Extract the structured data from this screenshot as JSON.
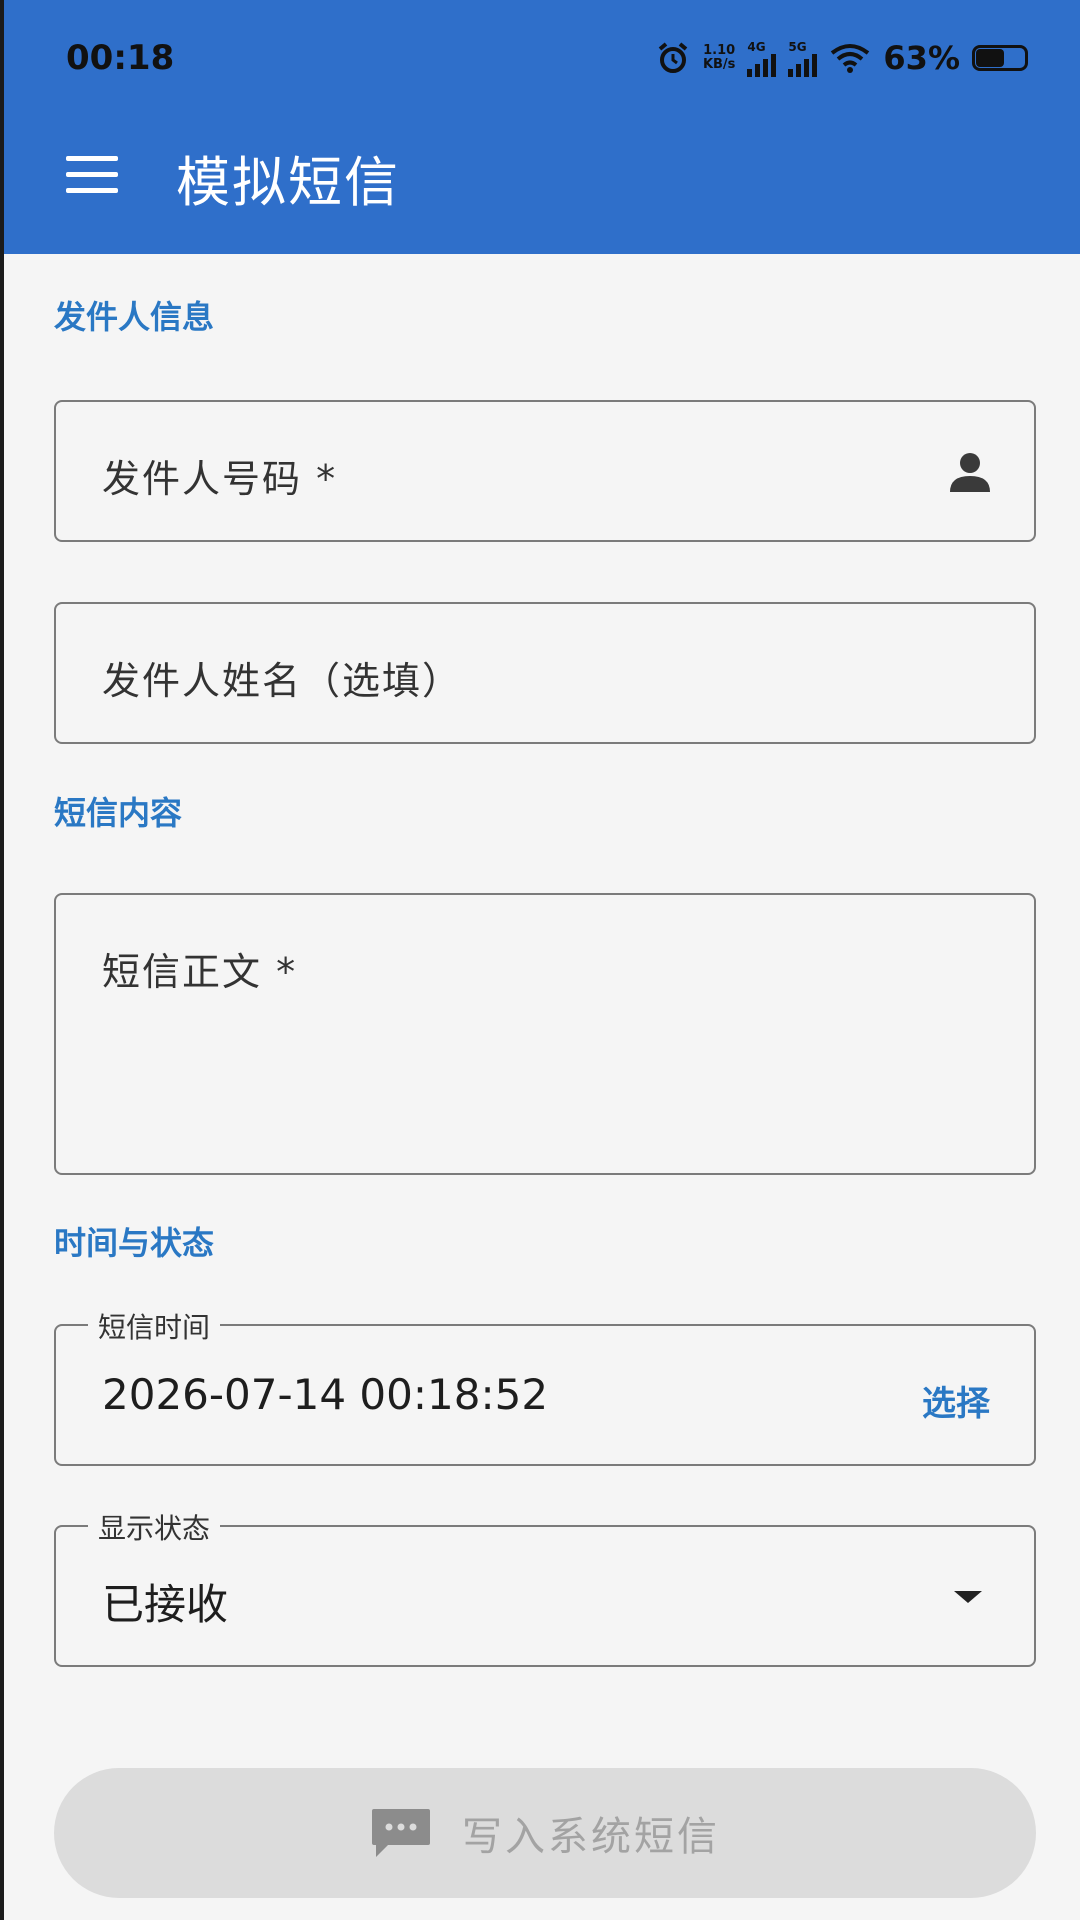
{
  "status_bar": {
    "time": "00:18",
    "net_speed_value": "1.10",
    "net_speed_unit": "KB/s",
    "signal1_tag": "4G",
    "signal2_tag": "5G",
    "battery_text": "63%",
    "battery_level": 0.63,
    "icons": [
      "alarm-icon",
      "signal-4g-icon",
      "signal-5g-icon",
      "wifi-icon",
      "battery-icon"
    ]
  },
  "app_bar": {
    "title": "模拟短信",
    "menu_icon": "hamburger-menu-icon"
  },
  "sections": {
    "sender": "发件人信息",
    "content": "短信内容",
    "time_status": "时间与状态"
  },
  "fields": {
    "sender_number": {
      "placeholder": "发件人号码 *",
      "icon": "person-icon"
    },
    "sender_name": {
      "placeholder": "发件人姓名（选填）"
    },
    "body": {
      "placeholder": "短信正文 *"
    },
    "sms_time": {
      "label": "短信时间",
      "value": "2026-07-14 00:18:52",
      "action": "选择"
    },
    "display_status": {
      "label": "显示状态",
      "value": "已接收",
      "icon": "dropdown-caret-icon"
    }
  },
  "submit": {
    "label": "写入系统短信",
    "icon": "message-icon"
  },
  "colors": {
    "app_bar": "#2f6fca",
    "accent": "#2a78c4",
    "background": "#f5f5f5",
    "disabled_button": "#dcdcdc",
    "disabled_text": "#a3a3a3"
  }
}
